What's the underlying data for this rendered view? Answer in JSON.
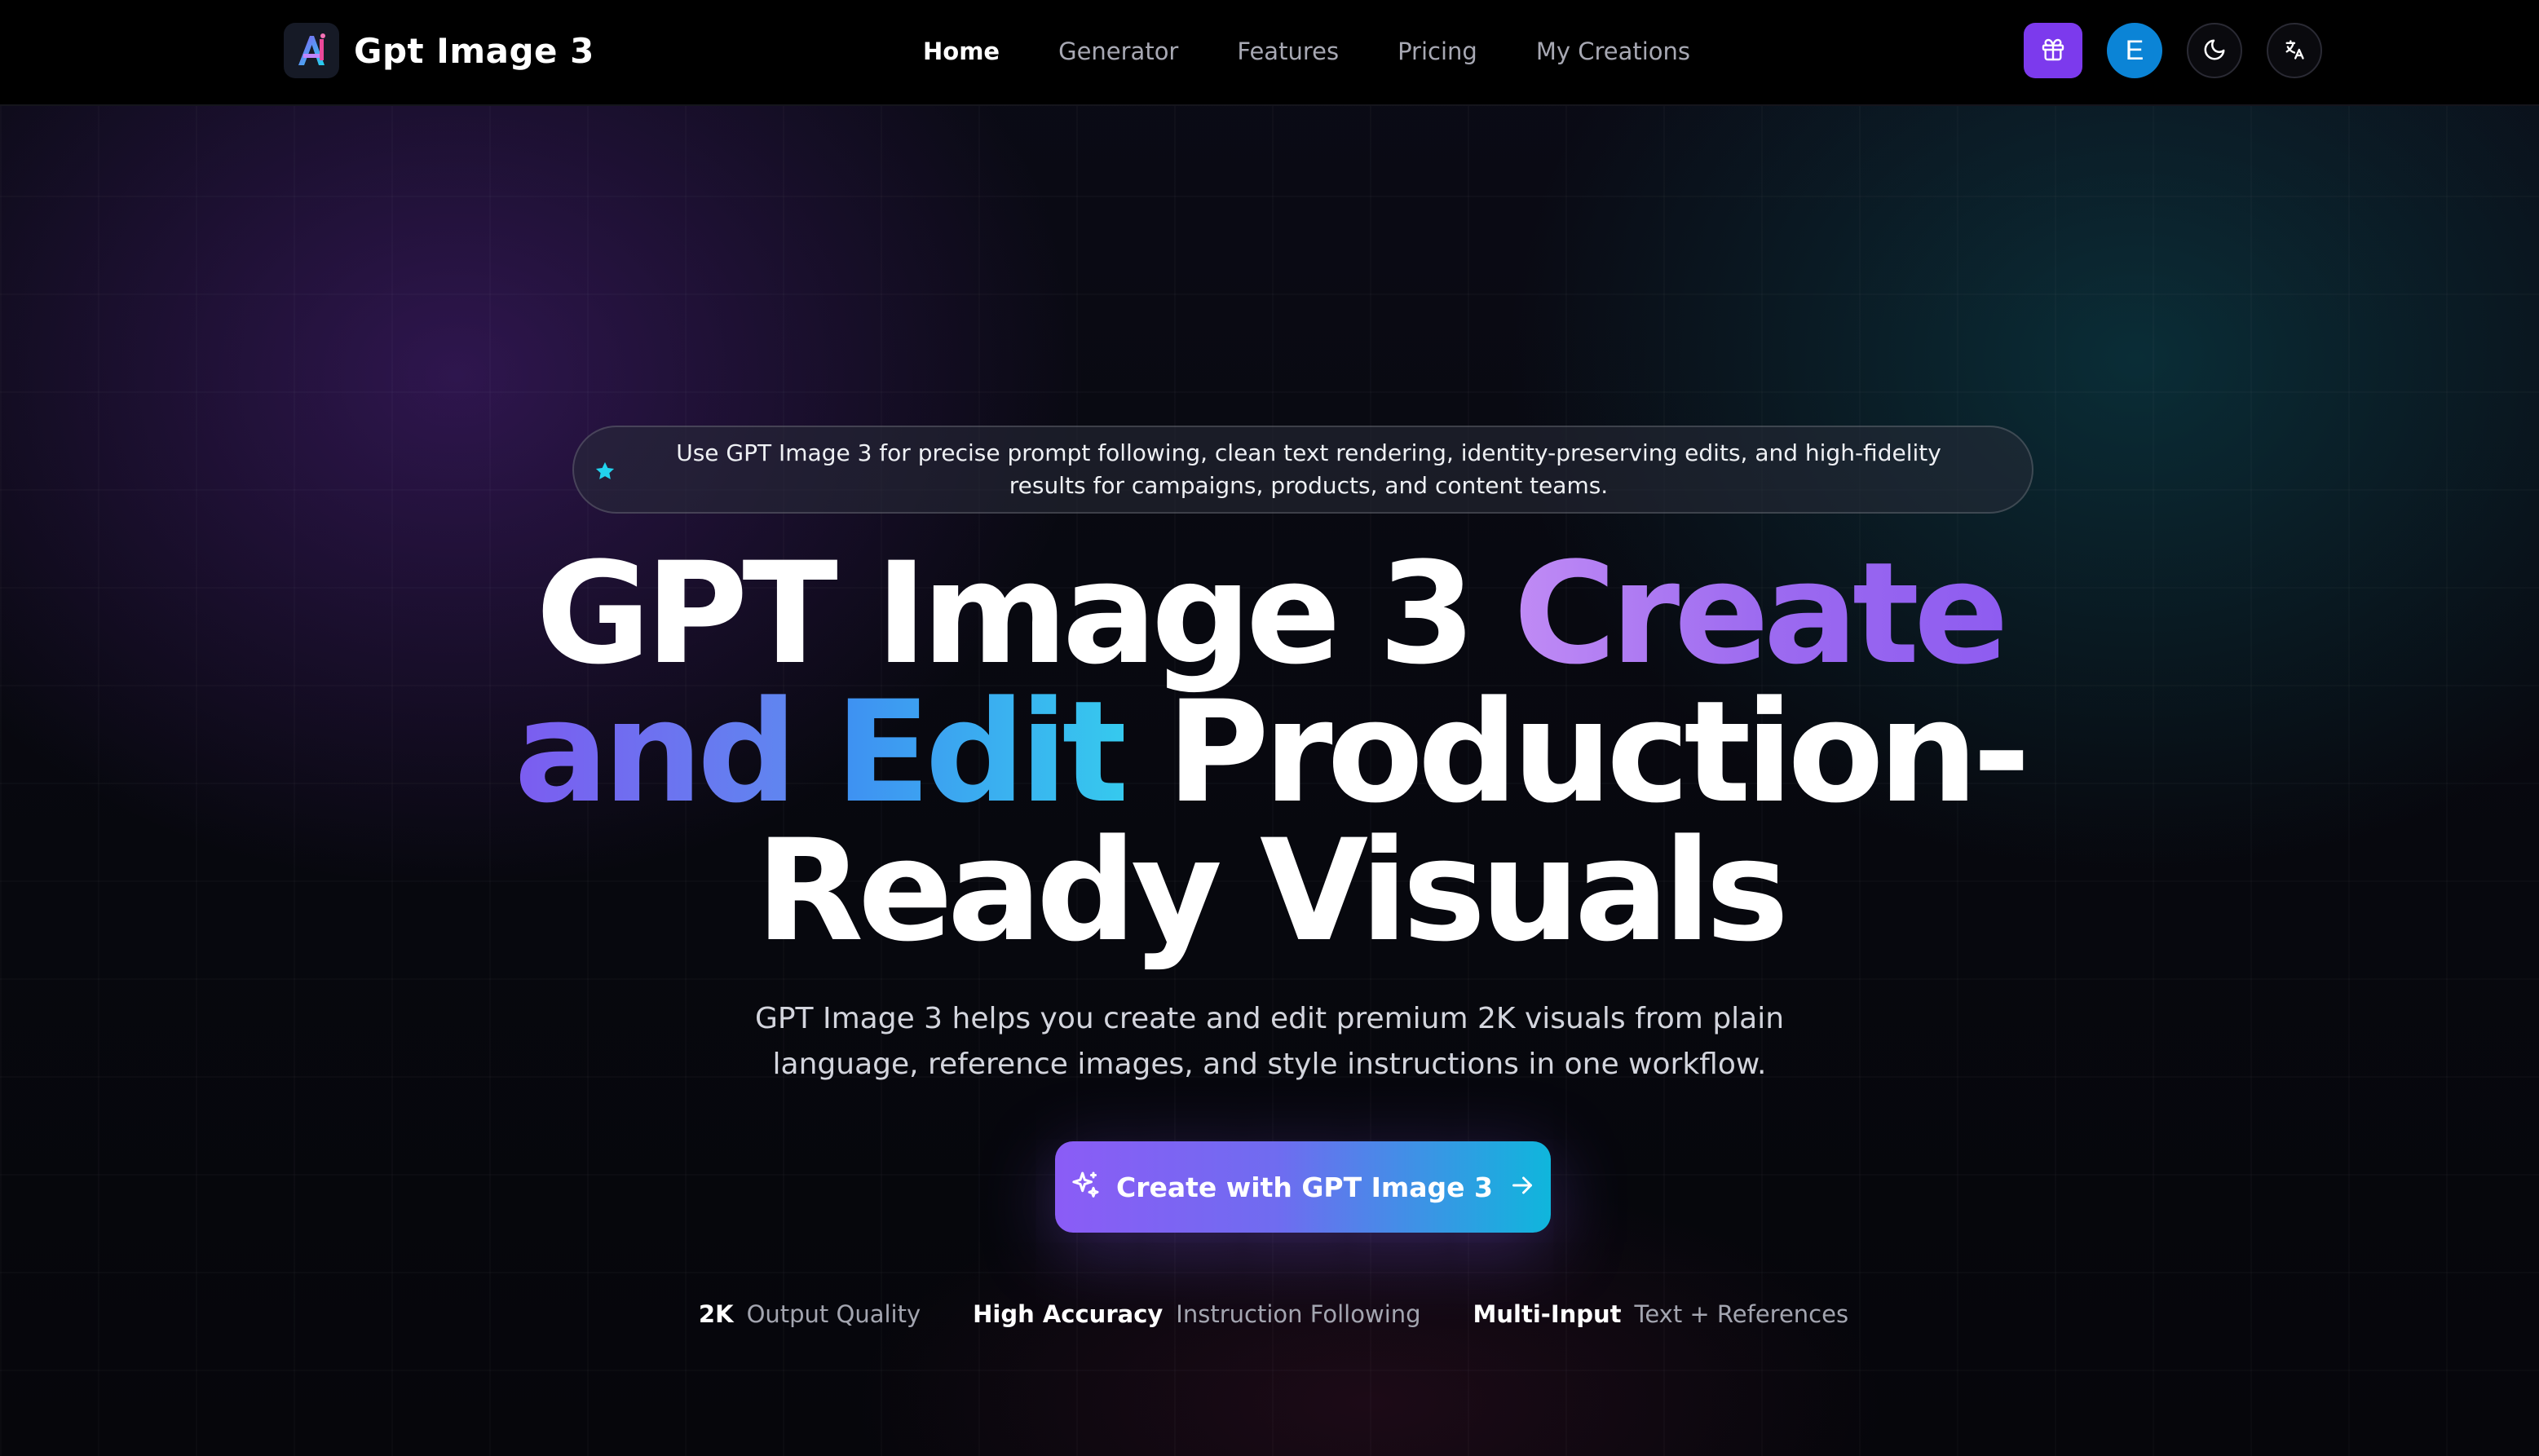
{
  "brand": {
    "name": "Gpt Image 3",
    "logo_icon": "ai-logo-icon"
  },
  "nav": {
    "links": [
      {
        "label": "Home",
        "active": true
      },
      {
        "label": "Generator",
        "active": false
      },
      {
        "label": "Features",
        "active": false
      },
      {
        "label": "Pricing",
        "active": false
      },
      {
        "label": "My Creations",
        "active": false
      }
    ],
    "actions": {
      "gift_icon": "gift-icon",
      "avatar_initial": "E",
      "theme_icon": "moon-icon",
      "language_icon": "translate-icon"
    }
  },
  "hero": {
    "announcement": "Use GPT Image 3 for precise prompt following, clean text rendering, identity-preserving edits, and high-fidelity results for campaigns, products, and content teams.",
    "title": {
      "part1": "GPT Image 3 ",
      "part2": "Create",
      "part3": "and ",
      "part4": "Edit",
      "part5": " Production-",
      "part6": "Ready Visuals"
    },
    "subtitle": "GPT Image 3 helps you create and edit premium 2K visuals from plain language, reference images, and style instructions in one workflow.",
    "cta_label": "Create with GPT Image 3",
    "stats": [
      {
        "value": "2K",
        "label": "Output Quality"
      },
      {
        "value": "High Accuracy",
        "label": "Instruction Following"
      },
      {
        "value": "Multi-Input",
        "label": "Text + References"
      }
    ]
  },
  "colors": {
    "accent_purple": "#7c3aed",
    "avatar_blue": "#0b84d6",
    "cta_start": "#8b5cf6",
    "cta_end": "#0fb6dc",
    "star_cyan": "#22d3ee"
  }
}
